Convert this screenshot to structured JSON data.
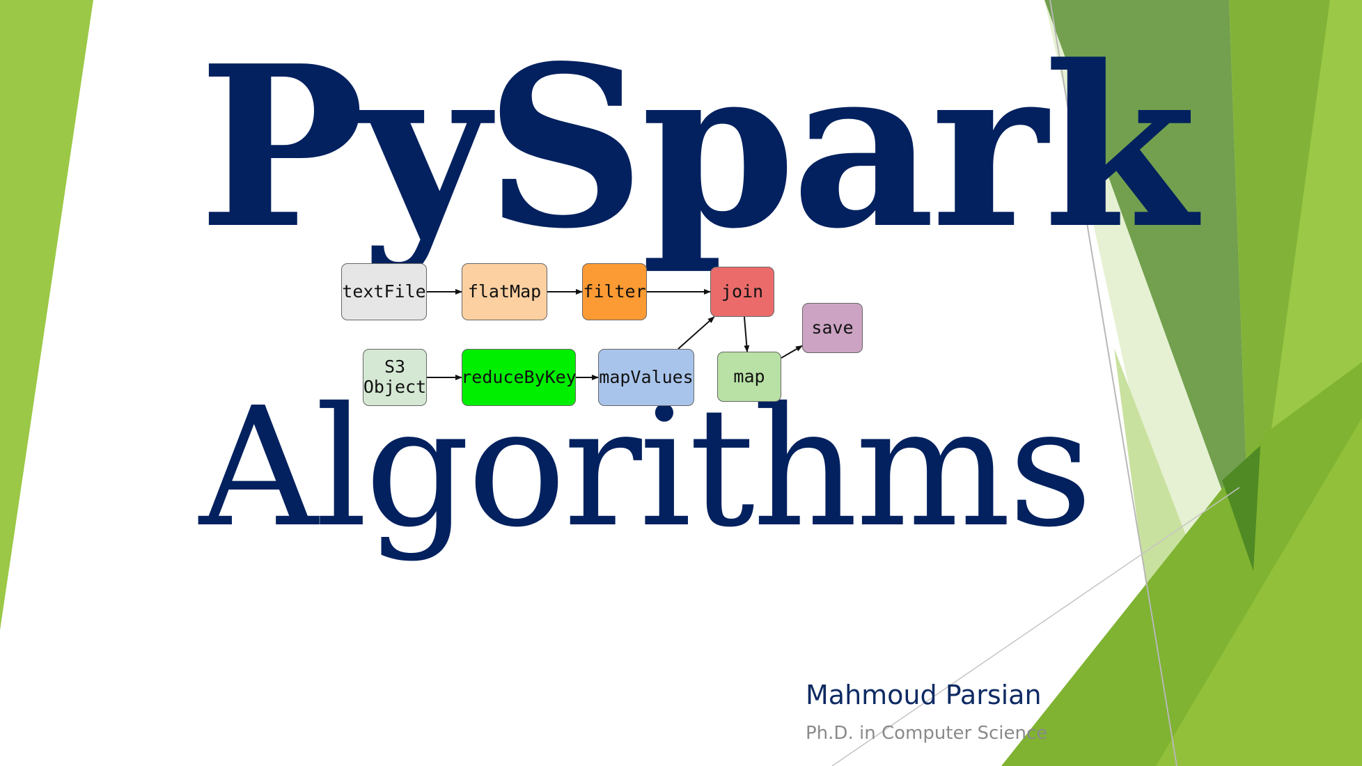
{
  "colors": {
    "title": "#03215f",
    "author": "#0e2a63",
    "degree": "#8a8a8a",
    "green_light": "#9bc846",
    "green_mid": "#7fb331",
    "green_dark": "#5f9a2e",
    "green_pale": "#dbebc2"
  },
  "title": {
    "main": "PySpark",
    "sub": "Algorithms"
  },
  "diagram": {
    "nodes": [
      {
        "id": "textFile",
        "label": "textFile",
        "color": "#e6e6e6"
      },
      {
        "id": "flatMap",
        "label": "flatMap",
        "color": "#fcd0a1"
      },
      {
        "id": "filter",
        "label": "filter",
        "color": "#fc9a33"
      },
      {
        "id": "join",
        "label": "join",
        "color": "#eb6b6b"
      },
      {
        "id": "save",
        "label": "save",
        "color": "#cca3c2"
      },
      {
        "id": "s3object",
        "label": "S3\nObject",
        "color": "#d5e8d4"
      },
      {
        "id": "reduceByKey",
        "label": "reduceByKey",
        "color": "#00ee00"
      },
      {
        "id": "mapValues",
        "label": "mapValues",
        "color": "#a9c4eb"
      },
      {
        "id": "map",
        "label": "map",
        "color": "#b9e0a5"
      }
    ],
    "edges": [
      {
        "from": "textFile",
        "to": "flatMap"
      },
      {
        "from": "flatMap",
        "to": "filter"
      },
      {
        "from": "filter",
        "to": "join"
      },
      {
        "from": "s3object",
        "to": "reduceByKey"
      },
      {
        "from": "reduceByKey",
        "to": "mapValues"
      },
      {
        "from": "mapValues",
        "to": "join"
      },
      {
        "from": "join",
        "to": "map"
      },
      {
        "from": "map",
        "to": "save"
      }
    ]
  },
  "author": {
    "name": "Mahmoud Parsian",
    "degree": "Ph.D. in Computer Science"
  }
}
